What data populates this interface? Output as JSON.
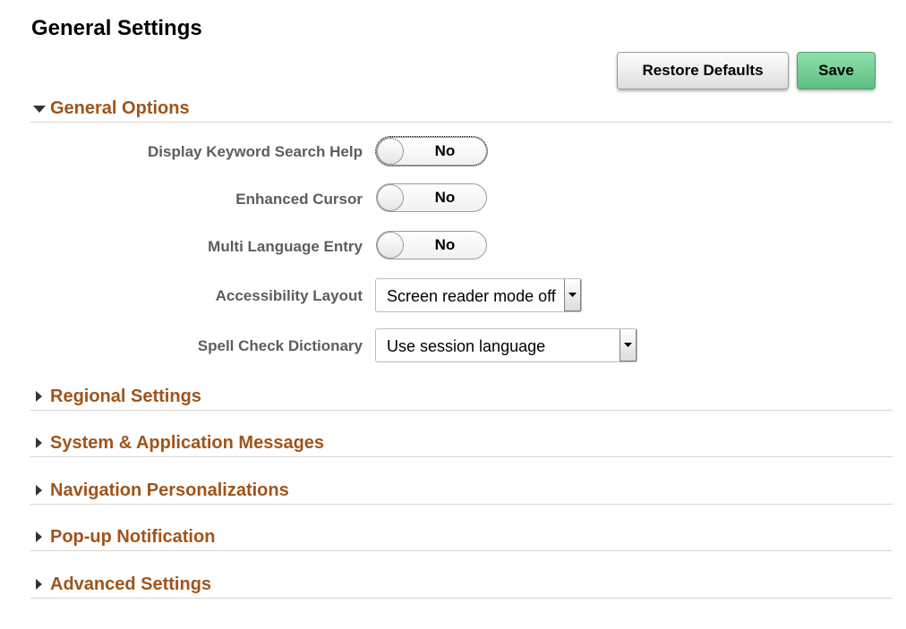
{
  "page": {
    "title": "General Settings"
  },
  "toolbar": {
    "restore_label": "Restore Defaults",
    "save_label": "Save"
  },
  "colors": {
    "section_title": "#a0541a",
    "save_button": "#6ccb8f",
    "label": "#5d5d5d"
  },
  "general_options": {
    "title": "General Options",
    "expanded": true,
    "fields": {
      "keyword_help": {
        "label": "Display Keyword Search Help",
        "value": "No"
      },
      "enhanced_cursor": {
        "label": "Enhanced Cursor",
        "value": "No"
      },
      "multi_language": {
        "label": "Multi Language Entry",
        "value": "No"
      },
      "accessibility": {
        "label": "Accessibility Layout",
        "value": "Screen reader mode off"
      },
      "spell_check": {
        "label": "Spell Check Dictionary",
        "value": "Use session language"
      }
    }
  },
  "sections": [
    {
      "title": "Regional Settings",
      "expanded": false
    },
    {
      "title": "System & Application Messages",
      "expanded": false
    },
    {
      "title": "Navigation Personalizations",
      "expanded": false
    },
    {
      "title": "Pop-up Notification",
      "expanded": false
    },
    {
      "title": "Advanced Settings",
      "expanded": false
    }
  ],
  "icons": {
    "expanded": "triangle-down-icon",
    "collapsed": "triangle-right-icon",
    "dropdown": "dropdown-arrow-icon"
  }
}
